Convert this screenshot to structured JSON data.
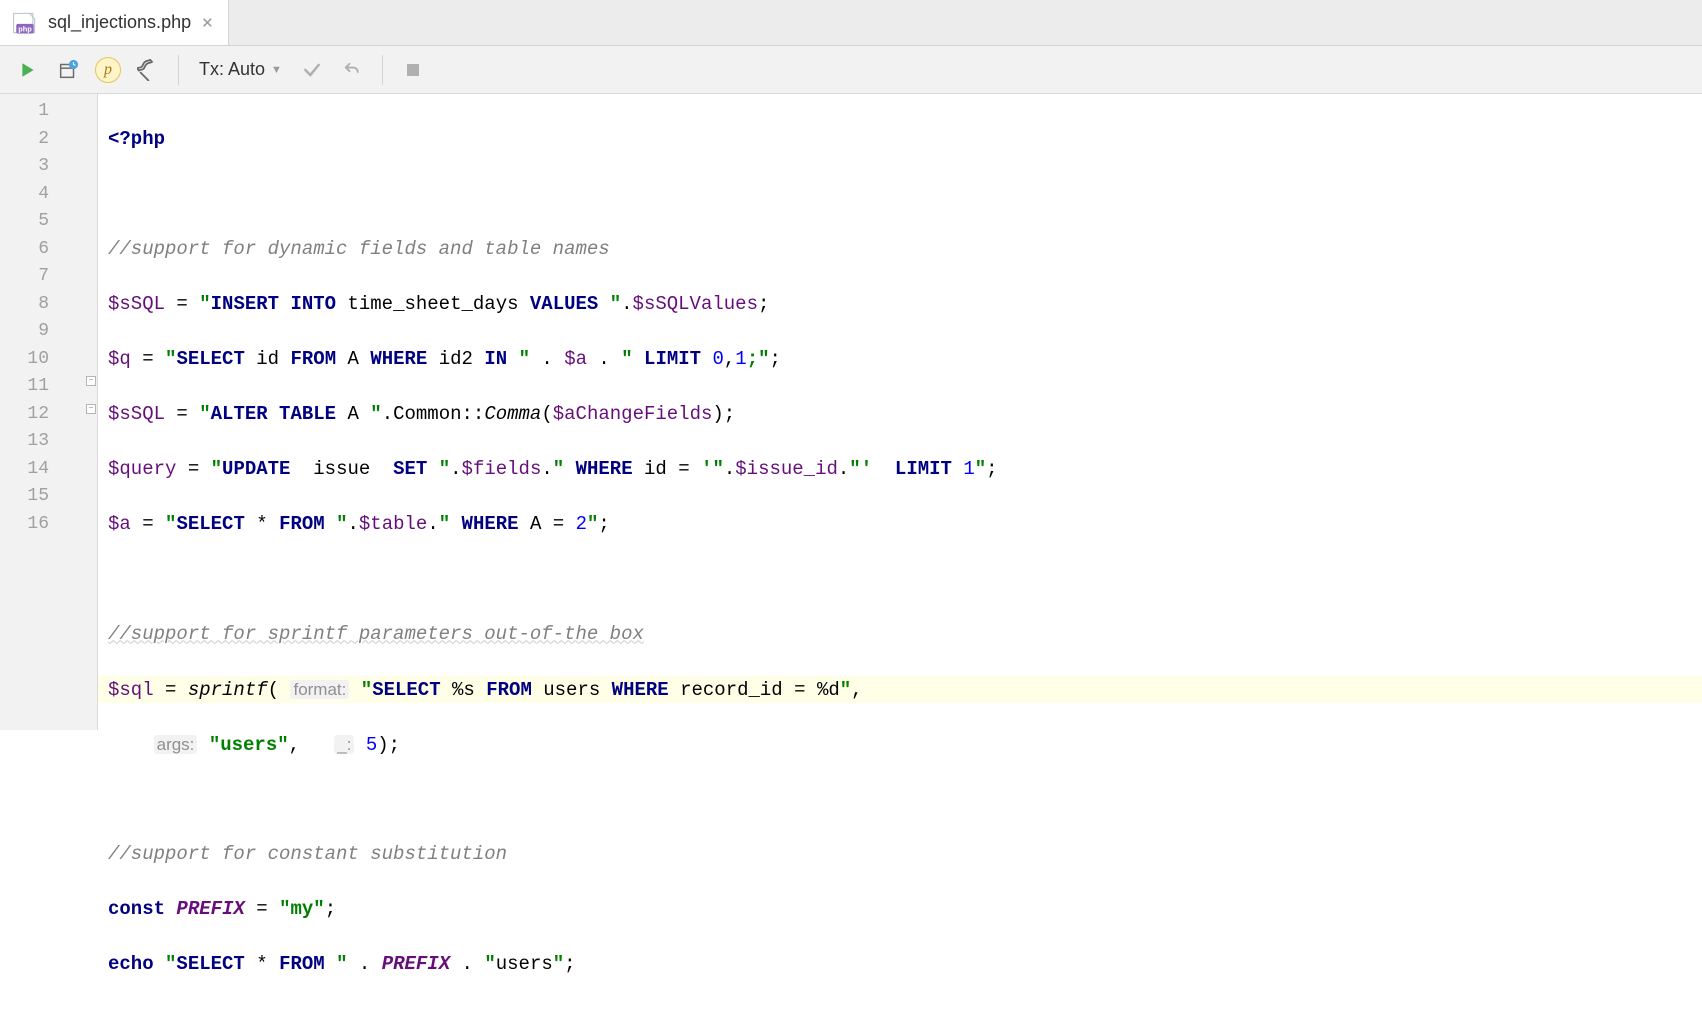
{
  "tab": {
    "filename": "sql_injections.php",
    "icon": "php-file-icon"
  },
  "toolbar": {
    "tx_label": "Tx: Auto"
  },
  "gutter": {
    "lines": [
      "1",
      "2",
      "3",
      "4",
      "5",
      "6",
      "7",
      "8",
      "9",
      "10",
      "11",
      "12",
      "13",
      "14",
      "15",
      "16"
    ]
  },
  "code": {
    "l1": {
      "open": "<?php"
    },
    "l3": {
      "comment": "//support for dynamic fields and table names"
    },
    "l4": {
      "var": "$sSQL",
      "eq": " = ",
      "q1": "\"",
      "kw1": "INSERT INTO",
      "sp1": " ",
      "id1": "time_sheet_days",
      "sp2": " ",
      "kw2": "VALUES",
      "sp3": " ",
      "q2": "\"",
      "dot": ".",
      "var2": "$sSQLValues",
      "semi": ";"
    },
    "l5": {
      "var": "$q",
      "eq": " = ",
      "q1": "\"",
      "kw1": "SELECT",
      "sp1": " ",
      "id1": "id",
      "sp2": " ",
      "kw2": "FROM",
      "sp3": " ",
      "id2": "A",
      "sp4": " ",
      "kw3": "WHERE",
      "sp5": " ",
      "id3": "id2",
      "sp6": " ",
      "kw4": "IN",
      "sp7": " ",
      "q2": "\"",
      "cat1": " . ",
      "var2": "$a",
      "cat2": " . ",
      "q3": "\"",
      "sp8": " ",
      "kw5": "LIMIT",
      "sp9": " ",
      "n1": "0",
      "comma": ",",
      "n2": "1",
      "semiin": ";",
      "q4": "\"",
      "semi2": ";"
    },
    "l6": {
      "var": "$sSQL",
      "eq": " = ",
      "q1": "\"",
      "kw1": "ALTER TABLE",
      "sp1": " ",
      "id1": "A",
      "sp2": " ",
      "q2": "\"",
      "dot": ".",
      "cls": "Common",
      "dc": "::",
      "fn": "Comma",
      "op": "(",
      "var2": "$aChangeFields",
      "cp": ")",
      "semi": ";"
    },
    "l7": {
      "var": "$query",
      "eq": " = ",
      "q1": "\"",
      "kw1": "UPDATE",
      "sp1": "  ",
      "id1": "issue",
      "sp2": "  ",
      "kw2": "SET",
      "sp3": " ",
      "q2": "\"",
      "dot1": ".",
      "var2": "$fields",
      "dot2": ".",
      "q3": "\"",
      "sp4": " ",
      "kw3": "WHERE",
      "sp5": " ",
      "id2": "id",
      "sp6": " = ",
      "sq": "'",
      "q4": "\"",
      "dot3": ".",
      "var3": "$issue_id",
      "dot4": ".",
      "q5": "\"",
      "sq2": "'",
      "sp7": "  ",
      "kw4": "LIMIT",
      "sp8": " ",
      "n": "1",
      "q6": "\"",
      "semi": ";"
    },
    "l8": {
      "var": "$a",
      "eq": " = ",
      "q1": "\"",
      "kw1": "SELECT",
      "sp1": " * ",
      "kw2": "FROM",
      "sp2": " ",
      "q2": "\"",
      "dot1": ".",
      "var2": "$table",
      "dot2": ".",
      "q3": "\"",
      "sp3": " ",
      "kw3": "WHERE",
      "sp4": " ",
      "id": "A",
      "sp5": " = ",
      "n": "2",
      "q4": "\"",
      "semi": ";"
    },
    "l10": {
      "comment": "//support for sprintf parameters out-of-the box"
    },
    "l11": {
      "var": "$sql",
      "eq": " = ",
      "fn": "sprintf",
      "op": "( ",
      "hint": "format:",
      "sp": " ",
      "q1": "\"",
      "kw1": "SELECT",
      "sp1": " ",
      "ph1": "%s",
      "sp2": " ",
      "kw2": "FROM",
      "sp3": " ",
      "id1": "users",
      "sp4": " ",
      "kw3": "WHERE",
      "sp5": " ",
      "id2": "record_id",
      "sp6": " = ",
      "ph2": "%d",
      "q2": "\"",
      "comma": ","
    },
    "l12": {
      "indent": "    ",
      "hint1": "args:",
      "sp1": " ",
      "q1": "\"",
      "s": "users",
      "q2": "\"",
      "comma": ", ",
      "sp2": "  ",
      "hint2": "_:",
      "sp3": " ",
      "n": "5",
      "cp": ")",
      "semi": ";"
    },
    "l14": {
      "comment": "//support for constant substitution"
    },
    "l15": {
      "kw": "const",
      "sp": " ",
      "const": "PREFIX",
      "eq": " = ",
      "q1": "\"",
      "s": "my",
      "q2": "\"",
      "semi": ";"
    },
    "l16": {
      "kw": "echo",
      "sp": " ",
      "q1": "\"",
      "kw1": "SELECT",
      "sp1": " * ",
      "kw2": "FROM",
      "sp2": " ",
      "q2": "\"",
      "cat1": " . ",
      "const": "PREFIX",
      "cat2": " . ",
      "q3": "\"",
      "s": "users",
      "q4": "\"",
      "semi": ";"
    }
  }
}
